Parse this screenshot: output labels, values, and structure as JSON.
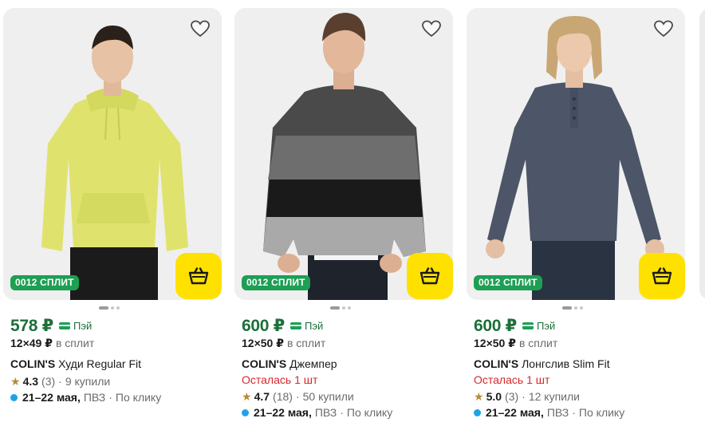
{
  "products": [
    {
      "badge": "0012 СПЛИТ",
      "price": "578 ₽",
      "pay_label": "Пэй",
      "split_price": "12×49 ₽",
      "split_note": "в сплит",
      "brand": "COLIN'S",
      "name": "Худи Regular Fit",
      "stock": "",
      "rating": "4.3",
      "reviews": "(3)",
      "bought": "9 купили",
      "dates": "21–22 мая,",
      "pickup": "ПВЗ",
      "pickup_note": "По клику",
      "garment_color": "#dfe36d"
    },
    {
      "badge": "0012 СПЛИТ",
      "price": "600 ₽",
      "pay_label": "Пэй",
      "split_price": "12×50 ₽",
      "split_note": "в сплит",
      "brand": "COLIN'S",
      "name": "Джемпер",
      "stock": "Осталась 1 шт",
      "rating": "4.7",
      "reviews": "(18)",
      "bought": "50 купили",
      "dates": "21–22 мая,",
      "pickup": "ПВЗ",
      "pickup_note": "По клику",
      "garment_color": "#4a4a4a"
    },
    {
      "badge": "0012 СПЛИТ",
      "price": "600 ₽",
      "pay_label": "Пэй",
      "split_price": "12×50 ₽",
      "split_note": "в сплит",
      "brand": "COLIN'S",
      "name": "Лонгслив Slim Fit",
      "stock": "Осталась 1 шт",
      "rating": "5.0",
      "reviews": "(3)",
      "bought": "12 купили",
      "dates": "21–22 мая,",
      "pickup": "ПВЗ",
      "pickup_note": "По клику",
      "garment_color": "#4d5668"
    }
  ],
  "icons": {
    "favorite": "heart-outline-icon",
    "cart": "basket-icon",
    "pay": "card-icon",
    "rating": "star-icon"
  },
  "colors": {
    "accent_yellow": "#ffe100",
    "price_green": "#1d6f3b",
    "badge_green": "#1d9f54",
    "stock_red": "#d8262c",
    "delivery_blue": "#1fa3e8"
  }
}
